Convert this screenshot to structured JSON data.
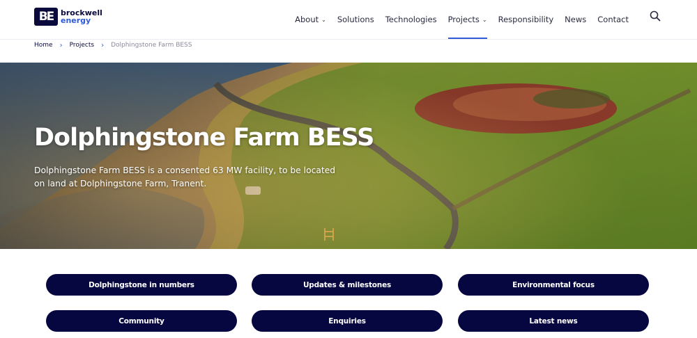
{
  "logo": {
    "mark": "BE",
    "line1": "brockwell",
    "line2": "energy"
  },
  "nav": {
    "items": [
      {
        "label": "About",
        "has_dropdown": true
      },
      {
        "label": "Solutions",
        "has_dropdown": false
      },
      {
        "label": "Technologies",
        "has_dropdown": false
      },
      {
        "label": "Projects",
        "has_dropdown": true
      },
      {
        "label": "Responsibility",
        "has_dropdown": false
      },
      {
        "label": "News",
        "has_dropdown": false
      },
      {
        "label": "Contact",
        "has_dropdown": false
      }
    ],
    "active": "Projects",
    "search_icon": "search-icon"
  },
  "breadcrumb": {
    "home": "Home",
    "projects": "Projects",
    "current": "Dolphingstone Farm BESS"
  },
  "hero": {
    "title": "Dolphingstone Farm BESS",
    "description": "Dolphingstone Farm BESS is a consented 63 MW facility, to be located on land at Dolphingstone Farm, Tranent."
  },
  "buttons": {
    "numbers": "Dolphingstone in numbers",
    "updates": "Updates & milestones",
    "environmental": "Environmental focus",
    "community": "Community",
    "enquiries": "Enquiries",
    "news": "Latest news"
  },
  "colors": {
    "brand_navy": "#060640",
    "accent_blue": "#2f5bd8"
  }
}
